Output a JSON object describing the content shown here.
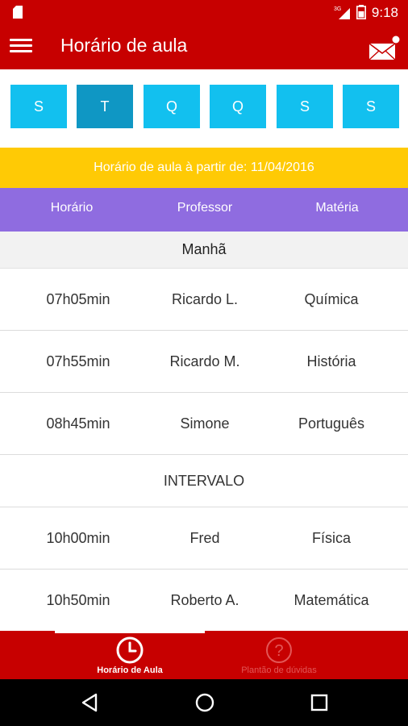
{
  "status_bar": {
    "time": "9:18",
    "network": "3G"
  },
  "app_bar": {
    "title": "Horário de aula"
  },
  "days": [
    "S",
    "T",
    "Q",
    "Q",
    "S",
    "S"
  ],
  "active_day_index": 1,
  "banner": "Horário de aula à partir de: 11/04/2016",
  "table_headers": {
    "time": "Horário",
    "teacher": "Professor",
    "subject": "Matéria"
  },
  "schedule": {
    "section": "Manhã",
    "rows": [
      {
        "time": "07h05min",
        "teacher": "Ricardo L.",
        "subject": "Química"
      },
      {
        "time": "07h55min",
        "teacher": "Ricardo M.",
        "subject": "História"
      },
      {
        "time": "08h45min",
        "teacher": "Simone",
        "subject": "Português"
      }
    ],
    "break_label": "INTERVALO",
    "rows_after": [
      {
        "time": "10h00min",
        "teacher": "Fred",
        "subject": "Física"
      },
      {
        "time": "10h50min",
        "teacher": "Roberto A.",
        "subject": "Matemática"
      }
    ]
  },
  "bottom_nav": [
    {
      "label": "Horário de Aula",
      "icon": "clock-icon",
      "active": true
    },
    {
      "label": "Plantão de dúvidas",
      "icon": "question-icon",
      "active": false
    }
  ],
  "colors": {
    "primary": "#c70000",
    "day_button": "#12c0ef",
    "day_active": "#0f97c4",
    "banner": "#ffca05",
    "header": "#8f6ce0"
  }
}
